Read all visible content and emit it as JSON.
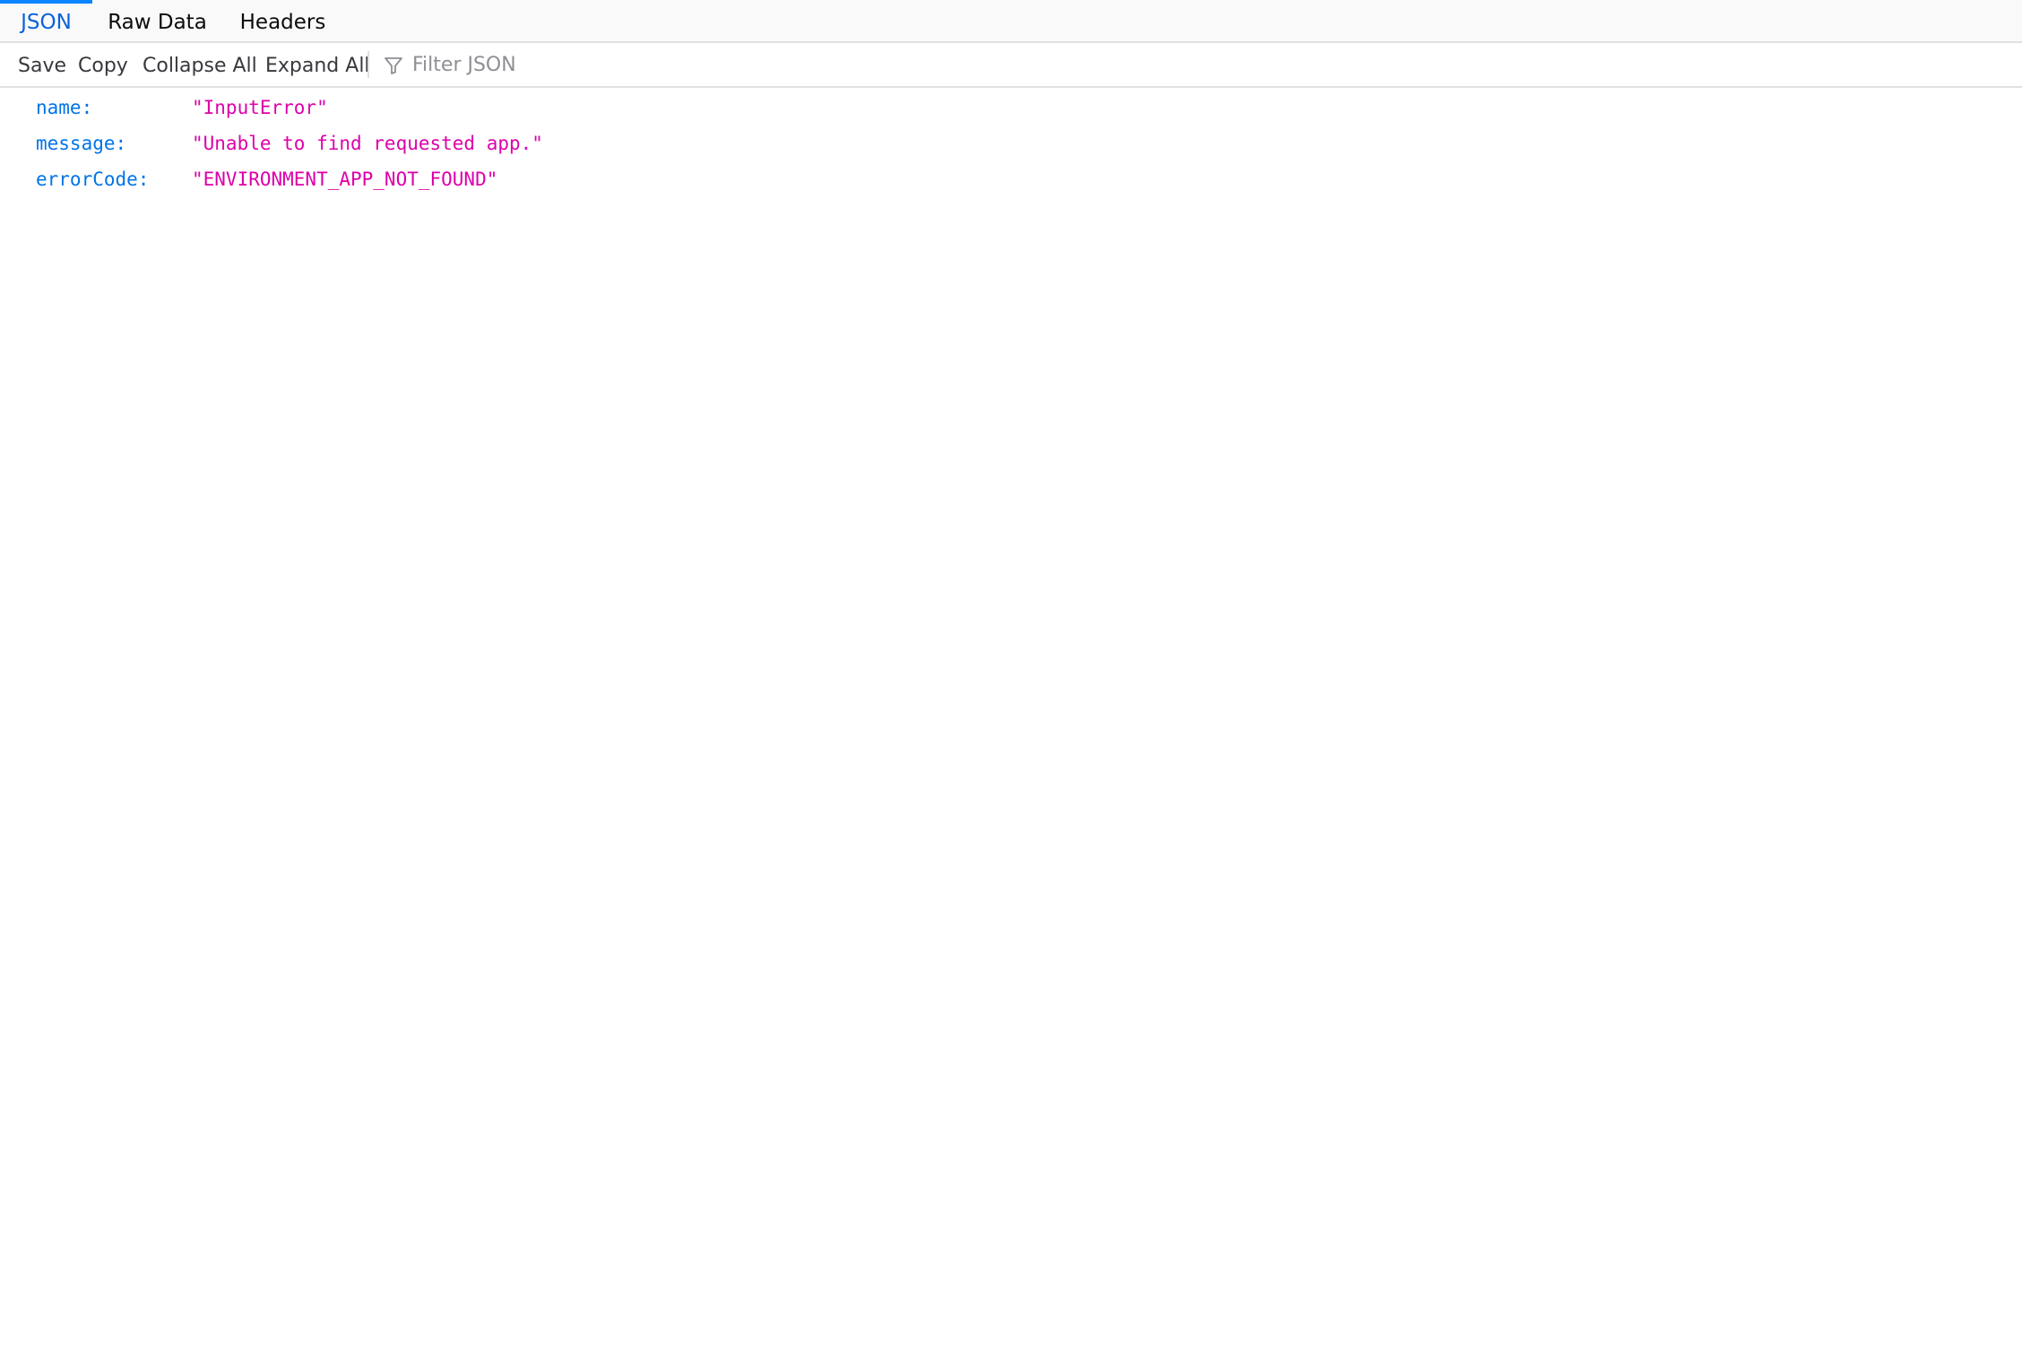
{
  "tabs": [
    {
      "label": "JSON",
      "selected": true
    },
    {
      "label": "Raw Data",
      "selected": false
    },
    {
      "label": "Headers",
      "selected": false
    }
  ],
  "toolbar": {
    "save_label": "Save",
    "copy_label": "Copy",
    "collapse_all_label": "Collapse All",
    "expand_all_label": "Expand All",
    "filter_placeholder": "Filter JSON",
    "filter_value": "",
    "filter_icon": "funnel-icon"
  },
  "json_rows": [
    {
      "key": "name:",
      "value": "\"InputError\""
    },
    {
      "key": "message:",
      "value": "\"Unable to find requested app.\""
    },
    {
      "key": "errorCode:",
      "value": "\"ENVIRONMENT_APP_NOT_FOUND\""
    }
  ],
  "colors": {
    "accent": "#0a84ff",
    "selected_tab_text": "#0a62d8",
    "json_key": "#0074e8",
    "json_string": "#dd00a9"
  }
}
